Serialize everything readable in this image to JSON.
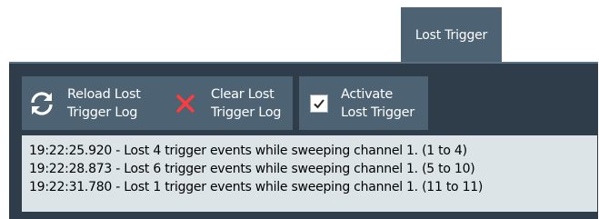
{
  "tab": {
    "label": "Lost Trigger"
  },
  "toolbar": {
    "reload": {
      "line1": "Reload Lost",
      "line2": "Trigger Log",
      "icon": "reload-icon"
    },
    "clear": {
      "line1": "Clear Lost",
      "line2": "Trigger Log",
      "icon": "close-icon",
      "icon_color": "#ff3b3b"
    },
    "activate": {
      "line1": "Activate",
      "line2": "Lost Trigger",
      "icon": "checkbox-icon",
      "checked": true
    }
  },
  "log": {
    "lines": [
      "19:22:25.920 - Lost 4 trigger events while sweeping channel 1. (1 to 4)",
      "19:22:28.873 - Lost 6 trigger events while sweeping channel 1. (5 to 10)",
      "19:22:31.780 - Lost 1 trigger events while sweeping channel 1. (11 to 11)"
    ]
  },
  "colors": {
    "panel_bg": "#2f3d4a",
    "button_bg": "#4d6272",
    "log_bg": "#dde4e8"
  }
}
